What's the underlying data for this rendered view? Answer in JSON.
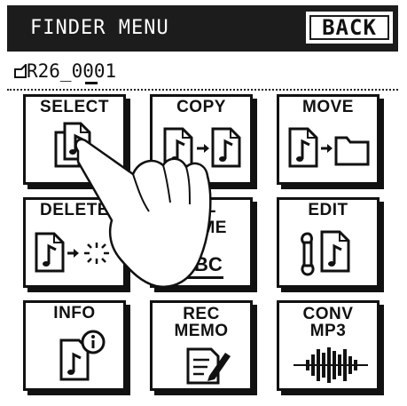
{
  "header": {
    "title": "FINDER MENU",
    "back_label": "BACK"
  },
  "file": {
    "name": "R26_0001"
  },
  "menu": {
    "select": "SELECT",
    "copy": "COPY",
    "move": "MOVE",
    "delete": "DELETE",
    "rename_line1": "RE-",
    "rename_line2": "NAME",
    "rename_abc": "ABC",
    "edit": "EDIT",
    "info": "INFO",
    "rec_memo_line1": "REC",
    "rec_memo_line2": "MEMO",
    "conv_line1": "CONV",
    "conv_line2": "MP3"
  },
  "colors": {
    "ink": "#111111",
    "header_bg": "#1c1c1c",
    "background": "#ffffff"
  },
  "icons": [
    "music-file-icon",
    "arrow-right-icon",
    "folder-icon",
    "trash-burst-icon",
    "wrench-icon",
    "info-icon",
    "memo-pencil-icon",
    "waveform-icon",
    "pointing-hand-icon"
  ]
}
